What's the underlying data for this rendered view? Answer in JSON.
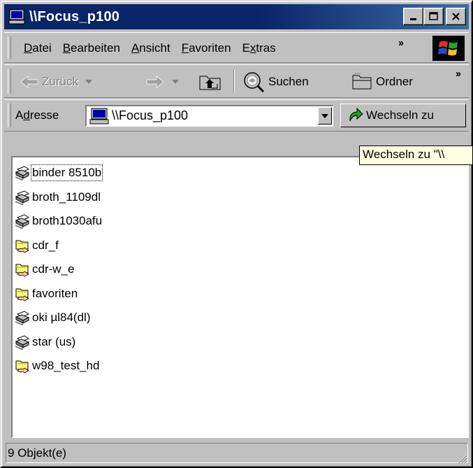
{
  "window": {
    "title": "\\\\Focus_p100"
  },
  "menu": [
    {
      "key": "D",
      "rest": "atei"
    },
    {
      "key": "B",
      "rest": "earbeiten"
    },
    {
      "key": "A",
      "rest": "nsicht"
    },
    {
      "key": "F",
      "rest": "avoriten"
    },
    {
      "pre": "E",
      "key": "x",
      "rest": "tras"
    }
  ],
  "toolbar": {
    "back_label": "Zurück",
    "search_label": "Suchen",
    "folders_label": "Ordner"
  },
  "address": {
    "label_pre": "A",
    "label_key": "d",
    "label_rest": "resse",
    "value": "\\\\Focus_p100",
    "go_label": "Wechseln zu"
  },
  "tooltip": {
    "text": "Wechseln zu \"\\\\"
  },
  "files": [
    {
      "name": "binder 8510b",
      "type": "printer"
    },
    {
      "name": "broth_1109dl",
      "type": "printer"
    },
    {
      "name": "broth1030afu",
      "type": "printer"
    },
    {
      "name": "cdr_f",
      "type": "shared-folder"
    },
    {
      "name": "cdr-w_e",
      "type": "shared-folder"
    },
    {
      "name": "favoriten",
      "type": "shared-folder"
    },
    {
      "name": "oki µl84(dl)",
      "type": "printer"
    },
    {
      "name": "star (us)",
      "type": "printer"
    },
    {
      "name": "w98_test_hd",
      "type": "shared-folder"
    }
  ],
  "status": {
    "text": "9 Objekt(e)"
  }
}
